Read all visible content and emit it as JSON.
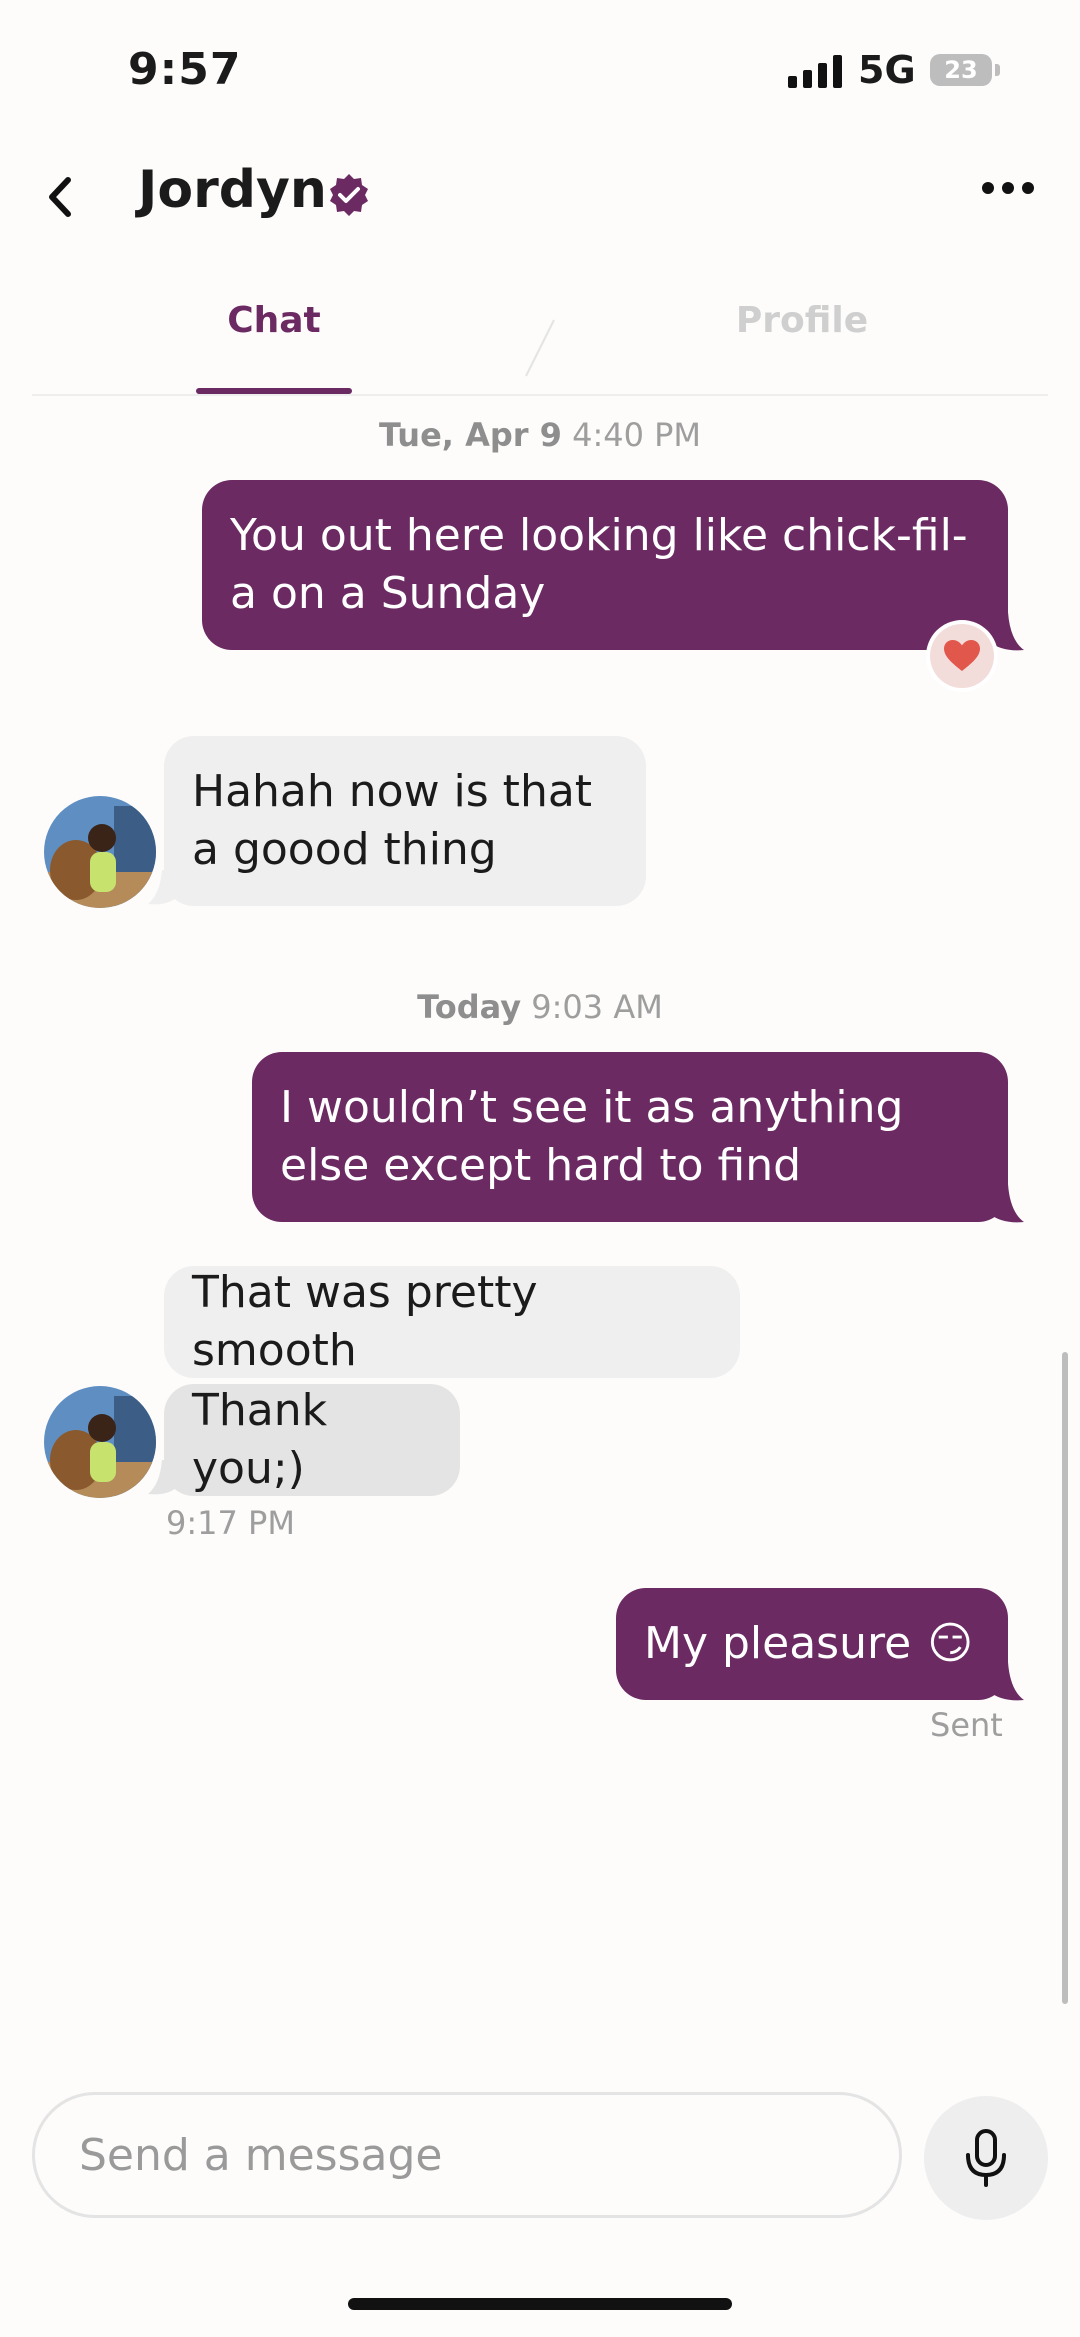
{
  "status_bar": {
    "time": "9:57",
    "network": "5G",
    "battery": "23"
  },
  "header": {
    "contact_name": "Jordyn",
    "tabs": [
      "Chat",
      "Profile"
    ],
    "active_tab": "Chat"
  },
  "colors": {
    "accent": "#6B2A62",
    "incoming_bubble": "#EFEFEF",
    "reaction_heart": "#E2574C"
  },
  "thread": {
    "stamp1": {
      "day": "Tue, Apr 9",
      "time": "4:40 PM"
    },
    "msg1": {
      "text": "You out here looking like chick-fil-a on a Sunday",
      "reaction": "heart-icon"
    },
    "msg2": {
      "text": "Hahah now is that a goood thing"
    },
    "stamp2": {
      "day": "Today",
      "time": "9:03 AM"
    },
    "msg3": {
      "text": "I wouldn’t see it as anything else except hard to find"
    },
    "msg4": {
      "text": "That was pretty smooth"
    },
    "msg5": {
      "text": "Thank you;)"
    },
    "msg5_time": "9:17 PM",
    "msg6": {
      "text": "My pleasure",
      "emoji": "😏"
    },
    "msg6_status": "Sent"
  },
  "composer": {
    "placeholder": "Send a message"
  }
}
